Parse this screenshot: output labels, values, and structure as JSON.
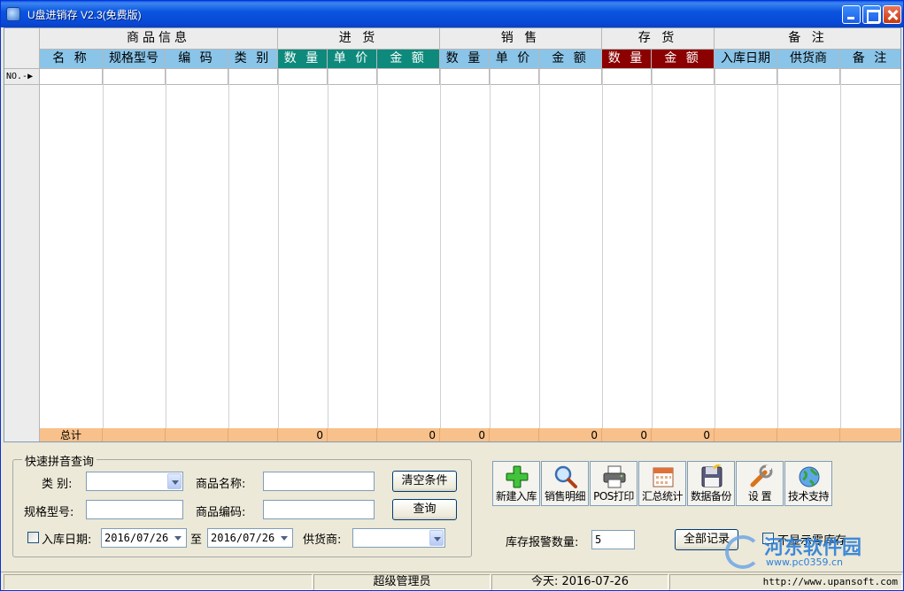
{
  "window": {
    "title": "U盘进销存 V2.3(免费版)"
  },
  "grid": {
    "groups": [
      {
        "label": "商品信息"
      },
      {
        "label": "进 货"
      },
      {
        "label": "销 售"
      },
      {
        "label": "存 货"
      },
      {
        "label": "备 注"
      }
    ],
    "columns": [
      "名 称",
      "规格型号",
      "编 码",
      "类 别",
      "数 量",
      "单 价",
      "金 额",
      "数 量",
      "单 价",
      "金 额",
      "数 量",
      "金 额",
      "入库日期",
      "供货商",
      "备 注"
    ],
    "row_marker": "NO.-▶",
    "totals_label": "总计",
    "totals": {
      "in_qty": "0",
      "in_amount": "0",
      "sale_qty": "0",
      "sale_amount": "0",
      "stock_qty": "0",
      "stock_amount": "0"
    }
  },
  "query": {
    "legend": "快速拼音查询",
    "category_label": "类 别:",
    "category_value": "",
    "name_label": "商品名称:",
    "name_value": "",
    "spec_label": "规格型号:",
    "spec_value": "",
    "code_label": "商品编码:",
    "code_value": "",
    "date_label": "入库日期:",
    "date_from": "2016/07/26",
    "date_to_label": "至",
    "date_to": "2016/07/26",
    "supplier_label": "供货商:",
    "supplier_value": "",
    "clear_button": "清空条件",
    "search_button": "查询"
  },
  "toolbar": {
    "items": [
      {
        "label": "新建入库",
        "icon": "plus-icon"
      },
      {
        "label": "销售明细",
        "icon": "magnifier-icon"
      },
      {
        "label": "POS打印",
        "icon": "printer-icon"
      },
      {
        "label": "汇总统计",
        "icon": "calendar-icon"
      },
      {
        "label": "数据备份",
        "icon": "floppy-icon"
      },
      {
        "label": "设 置",
        "icon": "wrench-icon"
      },
      {
        "label": "技术支持",
        "icon": "globe-icon"
      }
    ]
  },
  "alert": {
    "label": "库存报警数量:",
    "value": "5"
  },
  "all_records_button": "全部记录",
  "hide_zero_label": "不显示零库存",
  "status": {
    "user": "超级管理员",
    "today": "今天: 2016-07-26",
    "url": "http://www.upansoft.com"
  },
  "watermark": {
    "title": "河东软件园",
    "url": "www.pc0359.cn"
  },
  "colors": {
    "teal": "#0d8a7c",
    "maroon": "#8b0000",
    "header_blue": "#8ac4e8",
    "totals": "#f8c08a"
  }
}
